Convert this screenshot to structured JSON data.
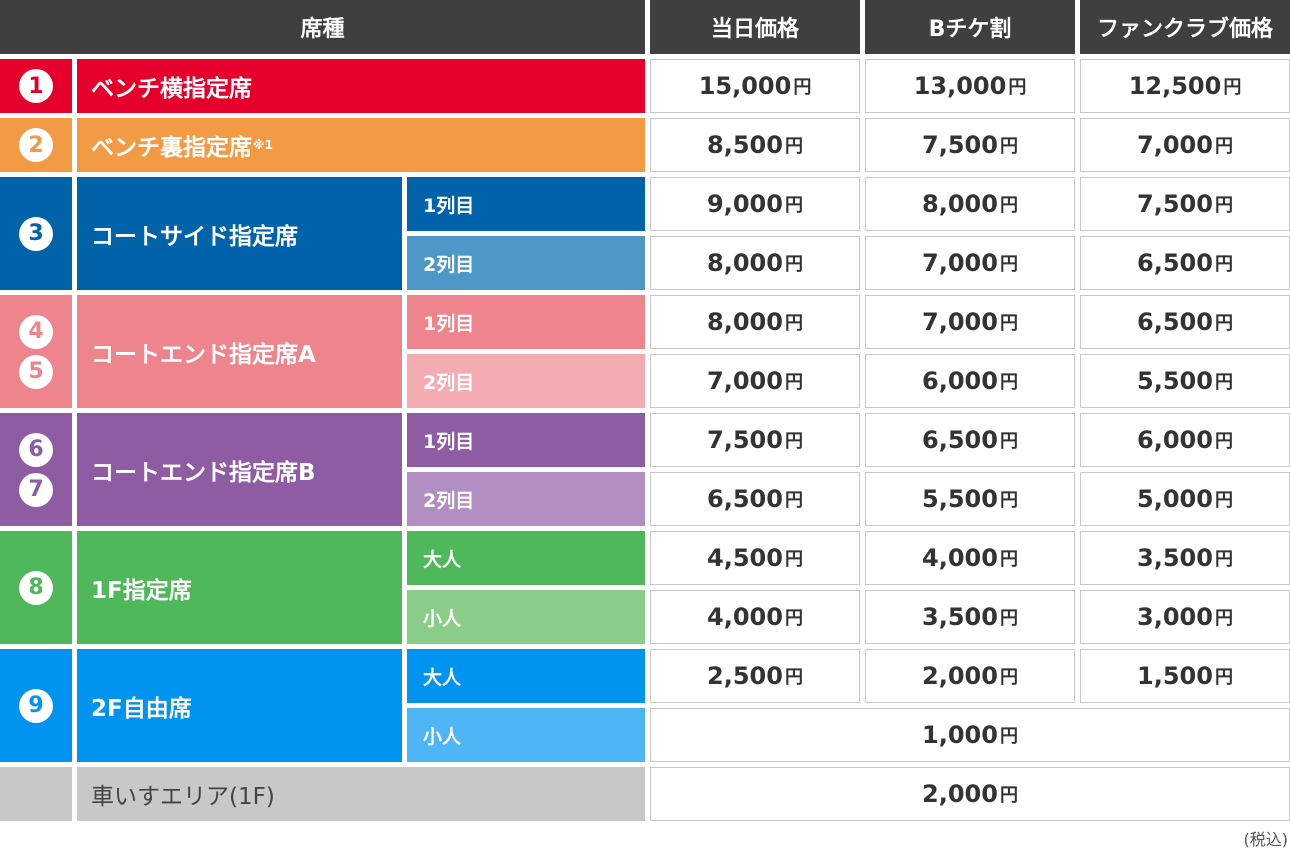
{
  "header": {
    "seat_type": "席種",
    "price_day": "当日価格",
    "price_bticket": "Bチケ割",
    "price_fanclub": "ファンクラブ価格"
  },
  "yen": "円",
  "rows": [
    {
      "badges": [
        "1"
      ],
      "name": "ベンチ横指定席",
      "sup": "",
      "color": "#e4002b",
      "badge_text": "#e4002b",
      "subs": [
        {
          "label": "",
          "prices": [
            "15,000",
            "13,000",
            "12,500"
          ]
        }
      ]
    },
    {
      "badges": [
        "2"
      ],
      "name": "ベンチ裏指定席",
      "sup": "※1",
      "color": "#f39a45",
      "badge_text": "#f39a45",
      "subs": [
        {
          "label": "",
          "prices": [
            "8,500",
            "7,500",
            "7,000"
          ]
        }
      ]
    },
    {
      "badges": [
        "3"
      ],
      "name": "コートサイド指定席",
      "sup": "",
      "color": "#0062a8",
      "badge_text": "#0062a8",
      "subs": [
        {
          "label": "1列目",
          "color": "#0062a8",
          "prices": [
            "9,000",
            "8,000",
            "7,500"
          ]
        },
        {
          "label": "2列目",
          "color": "#4e98c8",
          "prices": [
            "8,000",
            "7,000",
            "6,500"
          ]
        }
      ]
    },
    {
      "badges": [
        "4",
        "5"
      ],
      "name": "コートエンド指定席A",
      "sup": "",
      "color": "#ee848c",
      "badge_text": "#ee848c",
      "subs": [
        {
          "label": "1列目",
          "color": "#ee848c",
          "prices": [
            "8,000",
            "7,000",
            "6,500"
          ]
        },
        {
          "label": "2列目",
          "color": "#f4acb2",
          "prices": [
            "7,000",
            "6,000",
            "5,500"
          ]
        }
      ]
    },
    {
      "badges": [
        "6",
        "7"
      ],
      "name": "コートエンド指定席B",
      "sup": "",
      "color": "#8e5ca3",
      "badge_text": "#8e5ca3",
      "subs": [
        {
          "label": "1列目",
          "color": "#8e5ca3",
          "prices": [
            "7,500",
            "6,500",
            "6,000"
          ]
        },
        {
          "label": "2列目",
          "color": "#b18fc3",
          "prices": [
            "6,500",
            "5,500",
            "5,000"
          ]
        }
      ]
    },
    {
      "badges": [
        "8"
      ],
      "name": "1F指定席",
      "sup": "",
      "color": "#4fb85a",
      "badge_text": "#4fb85a",
      "subs": [
        {
          "label": "大人",
          "color": "#4fb85a",
          "prices": [
            "4,500",
            "4,000",
            "3,500"
          ]
        },
        {
          "label": "小人",
          "color": "#89cd89",
          "prices": [
            "4,000",
            "3,500",
            "3,000"
          ]
        }
      ]
    },
    {
      "badges": [
        "9"
      ],
      "name": "2F自由席",
      "sup": "",
      "color": "#0094f0",
      "badge_text": "#0094f0",
      "subs": [
        {
          "label": "大人",
          "color": "#0094f0",
          "prices": [
            "2,500",
            "2,000",
            "1,500"
          ]
        },
        {
          "label": "小人",
          "color": "#4fb6f5",
          "prices": [
            "1,000"
          ]
        }
      ]
    },
    {
      "badges": [],
      "name": "車いすエリア(1F)",
      "sup": "",
      "color": "#c8c8c8",
      "badge_text": "#c8c8c8",
      "name_color": "#444444",
      "subs": [
        {
          "label": "",
          "prices": [
            "2,000"
          ]
        }
      ]
    }
  ],
  "note": "(税込)"
}
